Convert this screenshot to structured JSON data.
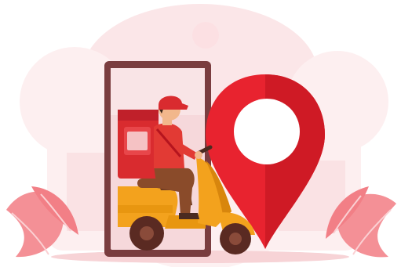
{
  "illustration": {
    "subject": "delivery-courier-on-scooter-with-location-pin-icon",
    "icons": [
      "location-pin-icon",
      "scooter-icon",
      "delivery-box-icon",
      "phone-frame-icon",
      "leaf-icon"
    ]
  },
  "colors": {
    "background": "#ffffff",
    "blob_light": "#fdeff0",
    "blob_mid": "#fbe3e5",
    "pin_red": "#e8232f",
    "pin_dark": "#b5141e",
    "phone_frame": "#7a3d3f",
    "phone_screen": "#f6d8db",
    "scooter_orange": "#f3a21d",
    "scooter_dark": "#d8860d",
    "box_red": "#d92b2f",
    "courier_shirt": "#e23a34",
    "courier_pants": "#8a4b2a",
    "skin": "#f2b78c",
    "leaf_pink": "#f27f86",
    "leaf_light": "#f9b6ba"
  }
}
